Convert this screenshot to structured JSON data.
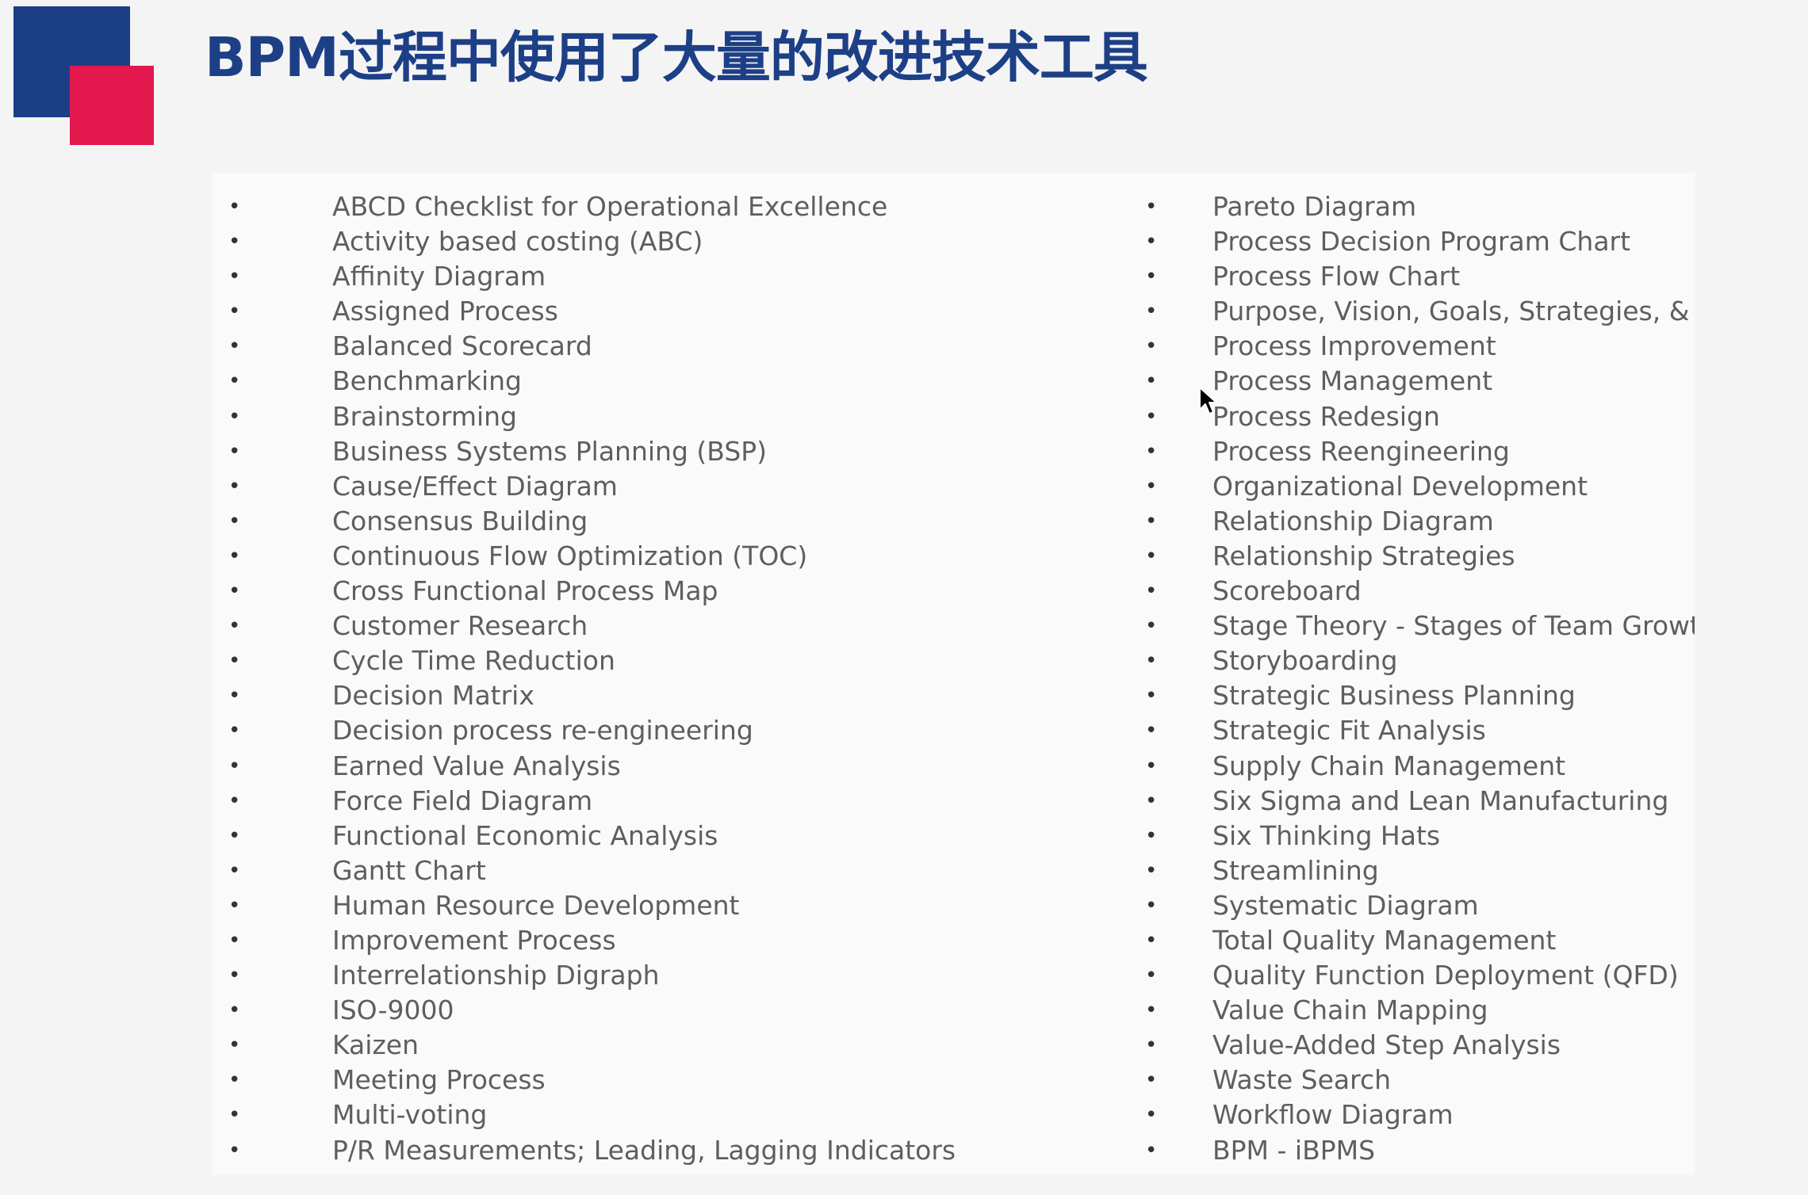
{
  "slide": {
    "title": "BPM过程中使用了大量的改进技术工具",
    "colors": {
      "title": "#1d3f86",
      "logo_blue": "#1b3f86",
      "logo_red": "#e3184d"
    },
    "bullet_symbol": "•",
    "left_items": [
      "ABCD Checklist for Operational Excellence",
      "Activity based costing (ABC)",
      "Affinity Diagram",
      "Assigned Process",
      "Balanced Scorecard",
      "Benchmarking",
      "Brainstorming",
      "Business Systems Planning (BSP)",
      "Cause/Effect Diagram",
      "Consensus Building",
      "Continuous Flow Optimization (TOC)",
      "Cross Functional Process Map",
      "Customer Research",
      "Cycle Time Reduction",
      "Decision Matrix",
      "Decision process re-engineering",
      "Earned Value Analysis",
      "Force Field Diagram",
      "Functional Economic Analysis",
      "Gantt Chart",
      "Human Resource Development",
      "Improvement Process",
      "Interrelationship Digraph",
      "ISO-9000",
      "Kaizen",
      "Meeting Process",
      "Multi-voting",
      "P/R Measurements;  Leading, Lagging Indicators"
    ],
    "right_items": [
      "Pareto Diagram",
      "Process Decision Program Chart",
      "Process Flow Chart",
      "Purpose, Vision, Goals, Strategies, & P",
      "Process Improvement",
      "Process Management",
      "Process Redesign",
      "Process Reengineering",
      "Organizational Development",
      "Relationship Diagram",
      "Relationship Strategies",
      "Scoreboard",
      "Stage Theory - Stages of Team Growth",
      "Storyboarding",
      "Strategic Business Planning",
      "Strategic Fit Analysis",
      "Supply Chain Management",
      "Six Sigma and Lean Manufacturing",
      "Six Thinking Hats",
      "Streamlining",
      "Systematic Diagram",
      "Total Quality Management",
      "Quality Function Deployment (QFD)",
      "Value Chain Mapping",
      "Value-Added Step Analysis",
      "Waste Search",
      "Workflow Diagram",
      "BPM - iBPMS"
    ]
  }
}
